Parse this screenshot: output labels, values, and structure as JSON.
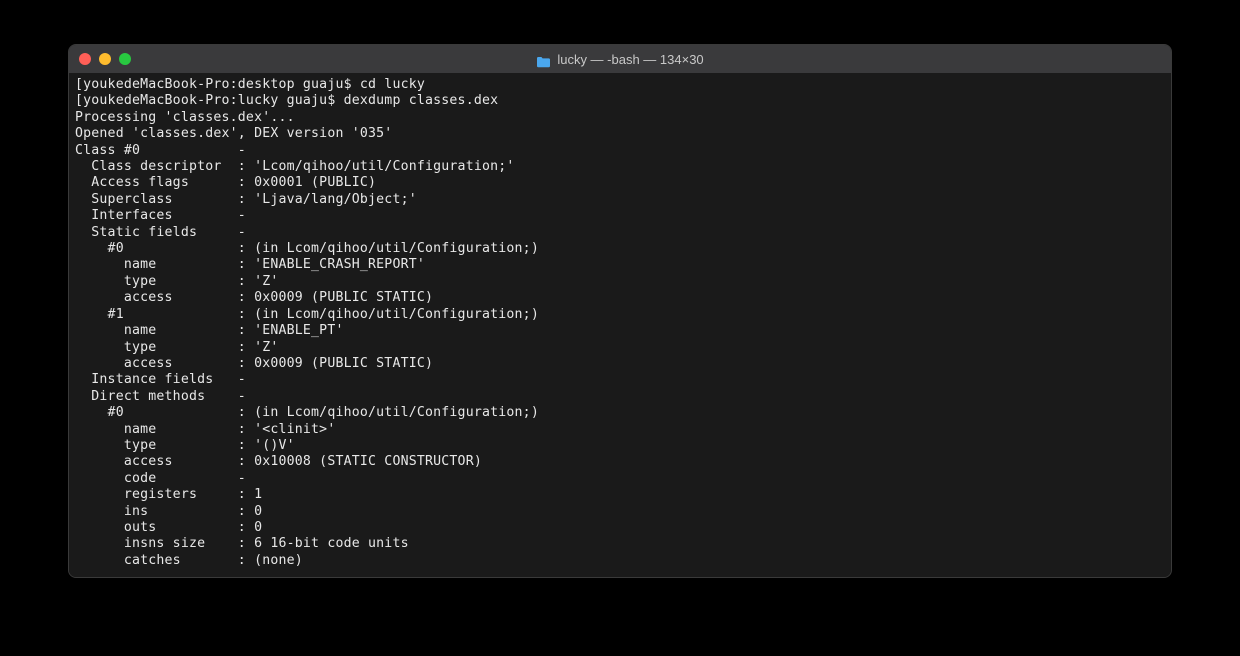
{
  "window": {
    "title": "lucky — -bash — 134×30"
  },
  "terminal": {
    "lines": [
      "[youkedeMacBook-Pro:desktop guaju$ cd lucky                                                                                            ]",
      "[youkedeMacBook-Pro:lucky guaju$ dexdump classes.dex                                                                                   ]",
      "Processing 'classes.dex'...",
      "Opened 'classes.dex', DEX version '035'",
      "Class #0            -",
      "  Class descriptor  : 'Lcom/qihoo/util/Configuration;'",
      "  Access flags      : 0x0001 (PUBLIC)",
      "  Superclass        : 'Ljava/lang/Object;'",
      "  Interfaces        -",
      "  Static fields     -",
      "    #0              : (in Lcom/qihoo/util/Configuration;)",
      "      name          : 'ENABLE_CRASH_REPORT'",
      "      type          : 'Z'",
      "      access        : 0x0009 (PUBLIC STATIC)",
      "    #1              : (in Lcom/qihoo/util/Configuration;)",
      "      name          : 'ENABLE_PT'",
      "      type          : 'Z'",
      "      access        : 0x0009 (PUBLIC STATIC)",
      "  Instance fields   -",
      "  Direct methods    -",
      "    #0              : (in Lcom/qihoo/util/Configuration;)",
      "      name          : '<clinit>'",
      "      type          : '()V'",
      "      access        : 0x10008 (STATIC CONSTRUCTOR)",
      "      code          -",
      "      registers     : 1",
      "      ins           : 0",
      "      outs          : 0",
      "      insns size    : 6 16-bit code units",
      "      catches       : (none)"
    ]
  }
}
